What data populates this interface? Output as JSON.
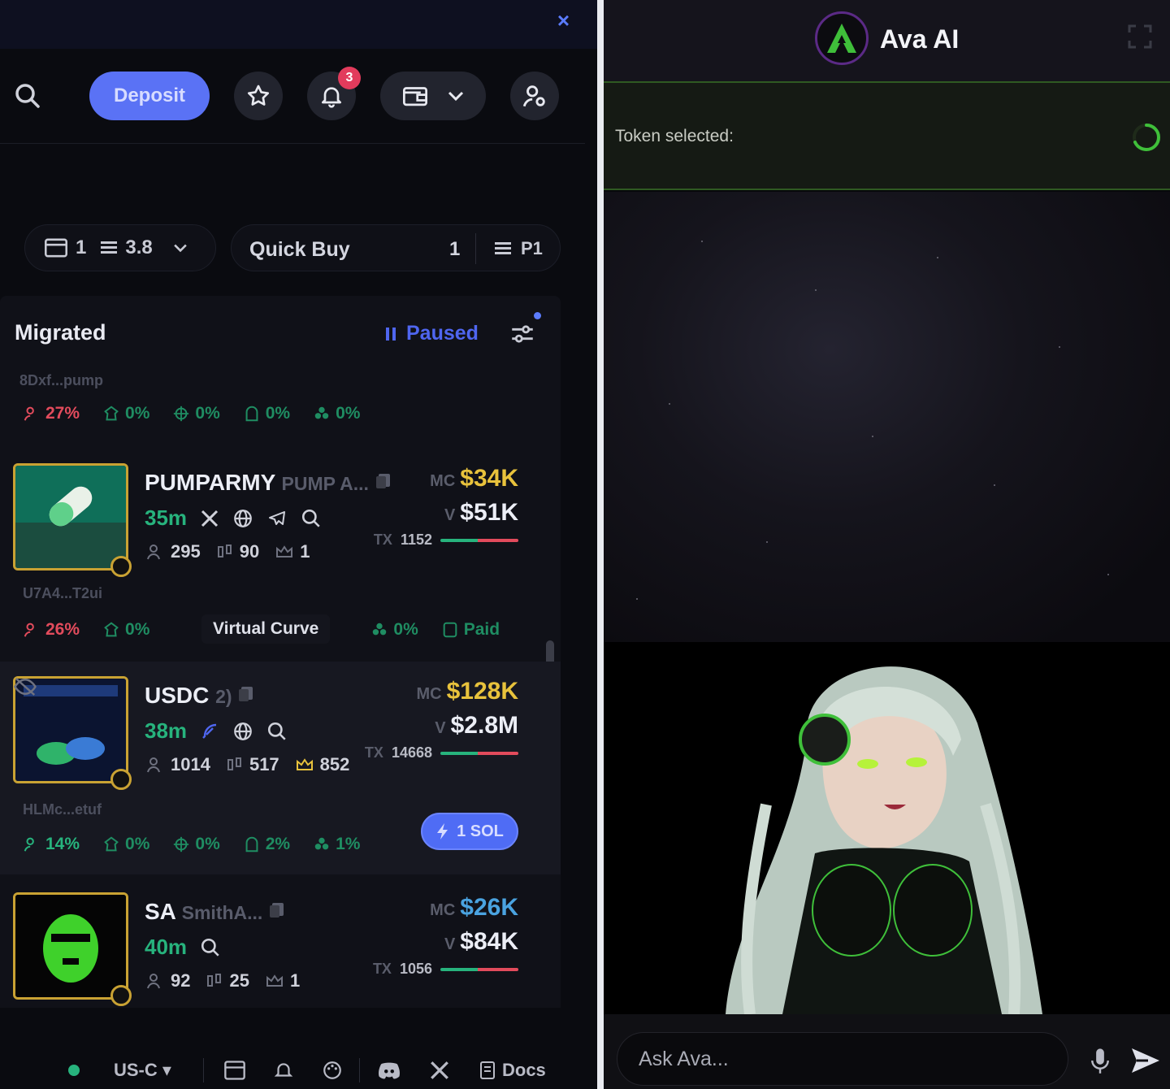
{
  "left_panel": {
    "close_glyph": "×",
    "toolbar": {
      "deposit_label": "Deposit",
      "notification_count": "3"
    },
    "quick_buy": {
      "wallet_count": "1",
      "balance": "3.8",
      "label": "Quick Buy",
      "amount": "1",
      "preset": "P1"
    },
    "migrated": {
      "title": "Migrated",
      "status": "Paused",
      "first_address": "8Dxf...pump",
      "first_stats": [
        "27%",
        "0%",
        "0%",
        "0%",
        "0%"
      ]
    },
    "tokens": [
      {
        "name": "PUMPARMY",
        "subname": "PUMP A...",
        "age": "35m",
        "holders": "295",
        "buys": "90",
        "kols": "1",
        "mc_label": "MC",
        "mc": "$34K",
        "v_label": "V",
        "volume": "$51K",
        "tx_label": "TX",
        "tx": "1152",
        "address": "U7A4...T2ui",
        "stats": [
          "26%",
          "0%",
          "0%",
          "Paid"
        ]
      },
      {
        "name": "USDC",
        "subname": "2)",
        "age": "38m",
        "holders": "1014",
        "buys": "517",
        "kols": "852",
        "mc_label": "MC",
        "mc": "$128K",
        "v_label": "V",
        "volume": "$2.8M",
        "tx_label": "TX",
        "tx": "14668",
        "address": "HLMc...etuf",
        "stats": [
          "14%",
          "0%",
          "0%",
          "2%",
          "1%"
        ]
      },
      {
        "name": "SA",
        "subname": "SmithA...",
        "age": "40m",
        "holders": "92",
        "buys": "25",
        "kols": "1",
        "mc_label": "MC",
        "mc": "$26K",
        "v_label": "V",
        "volume": "$84K",
        "tx_label": "TX",
        "tx": "1056"
      }
    ],
    "tooltip": "Virtual Curve",
    "sol_button": "1 SOL",
    "footer": {
      "region": "US-C",
      "docs": "Docs"
    }
  },
  "right_panel": {
    "title": "Ava AI",
    "token_selected_label": "Token selected:",
    "chat_placeholder": "Ask Ava..."
  },
  "colors": {
    "accent_blue": "#5a72f5",
    "green": "#27b37d",
    "red": "#e24b5c",
    "gold": "#e8c23c",
    "ava_green": "#3fbf3a"
  }
}
